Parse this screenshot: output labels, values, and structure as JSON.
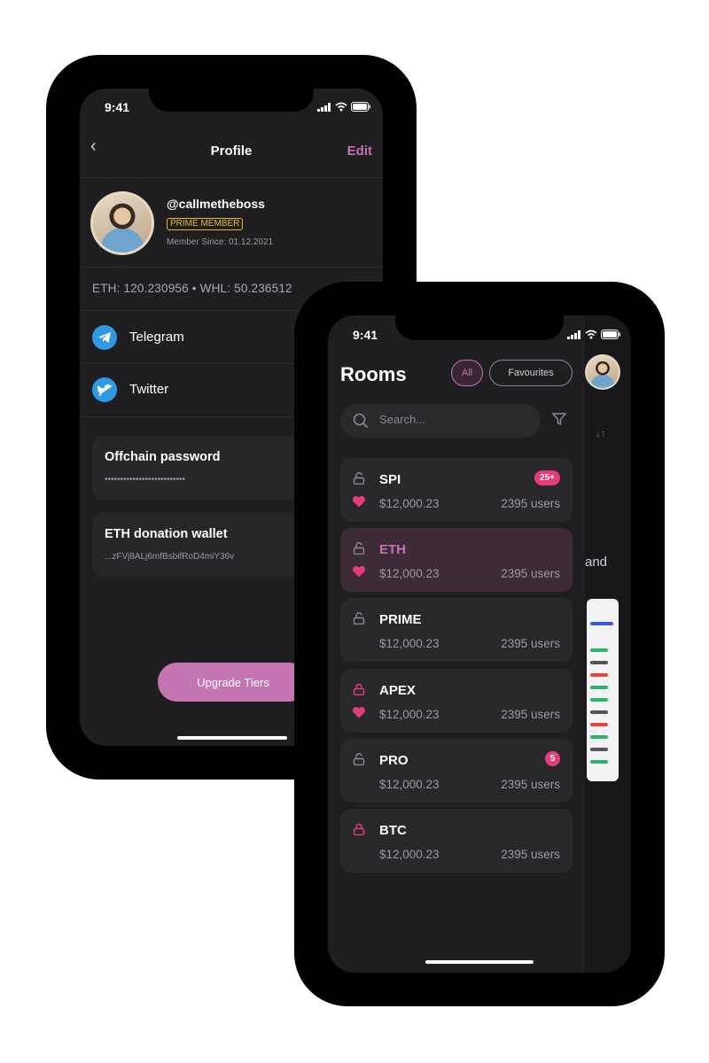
{
  "profile_screen": {
    "status_time": "9:41",
    "title": "Profile",
    "edit_label": "Edit",
    "back_glyph": "‹",
    "username": "@callmetheboss",
    "badge": "PRIME MEMBER",
    "member_since": "Member Since: 01.12.2021",
    "balance": "ETH: 120.230956 • WHL: 50.236512",
    "socials": [
      {
        "label": "Telegram",
        "icon": "telegram-icon"
      },
      {
        "label": "Twitter",
        "icon": "twitter-icon"
      }
    ],
    "cards": [
      {
        "title": "Offchain password",
        "value": "••••••••••••••••••••••••••"
      },
      {
        "title": "ETH donation wallet",
        "value": "...zFVj8ALj6mfBsbifRoD4miY36v"
      }
    ],
    "upgrade_label": "Upgrade Tiers"
  },
  "rooms_screen": {
    "status_time": "9:41",
    "title": "Rooms",
    "filters": [
      "All",
      "Favourites"
    ],
    "active_filter": "All",
    "search_placeholder": "Search...",
    "side_text": "and",
    "rooms": [
      {
        "name": "SPI",
        "price": "$12,000.23",
        "users": "2395 users",
        "badge": "25+",
        "favorite": true,
        "lock_color": "#8a8a90",
        "selected": false
      },
      {
        "name": "ETH",
        "price": "$12,000.23",
        "users": "2395 users",
        "badge": "",
        "favorite": true,
        "lock_color": "#8a8a90",
        "selected": true
      },
      {
        "name": "PRIME",
        "price": "$12,000.23",
        "users": "2395 users",
        "badge": "",
        "favorite": false,
        "lock_color": "#8a8a90",
        "selected": false
      },
      {
        "name": "APEX",
        "price": "$12,000.23",
        "users": "2395 users",
        "badge": "",
        "favorite": true,
        "lock_color": "#e83b7e",
        "selected": false
      },
      {
        "name": "PRO",
        "price": "$12,000.23",
        "users": "2395 users",
        "badge": "5",
        "favorite": false,
        "lock_color": "#8a8a90",
        "selected": false
      },
      {
        "name": "BTC",
        "price": "$12,000.23",
        "users": "2395 users",
        "badge": "",
        "favorite": false,
        "lock_color": "#e83b7e",
        "selected": false
      }
    ]
  },
  "colors": {
    "accent": "#c576b2",
    "badge": "#e83b7e",
    "gold": "#e8b93a",
    "telegram": "#2f9ae0"
  }
}
